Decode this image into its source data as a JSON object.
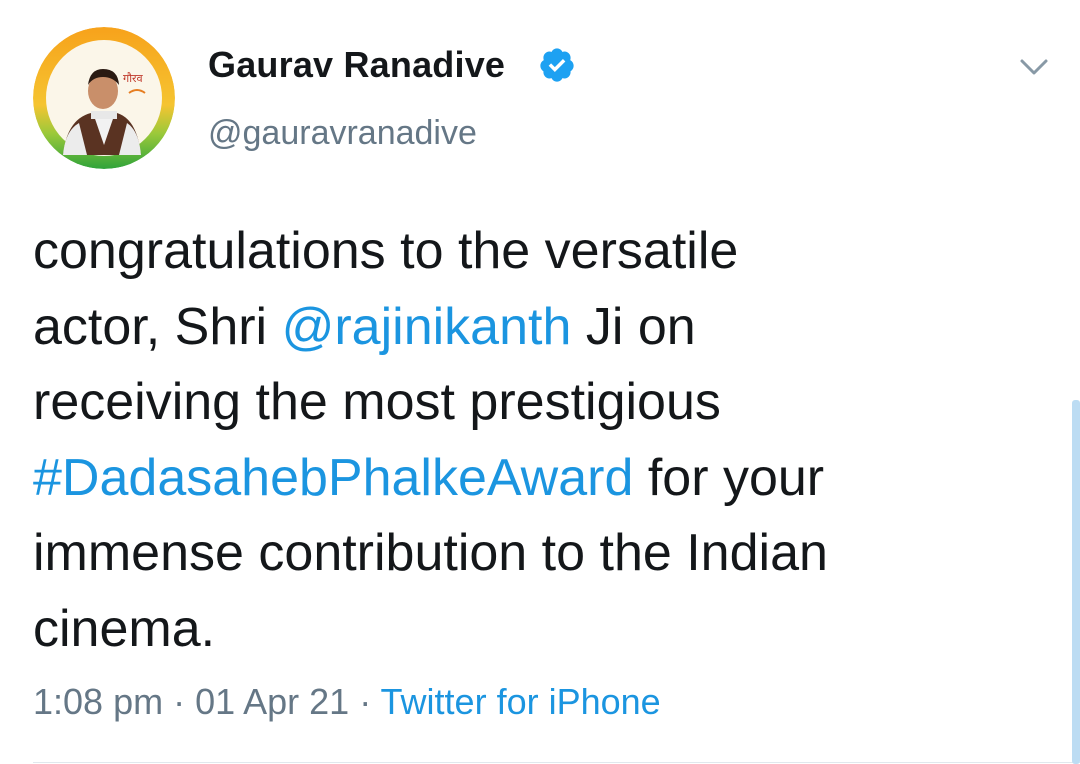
{
  "tweet": {
    "author": {
      "display_name": "Gaurav Ranadive",
      "handle": "@gauravranadive",
      "verified": true,
      "avatar_badge_text": "गौरव"
    },
    "text_lines": [
      [
        {
          "text": "congratulations to the versatile",
          "type": "text"
        }
      ],
      [
        {
          "text": "actor, Shri ",
          "type": "text"
        },
        {
          "text": "@rajinikanth",
          "type": "mention"
        },
        {
          "text": " Ji on",
          "type": "text"
        }
      ],
      [
        {
          "text": "receiving the most prestigious",
          "type": "text"
        }
      ],
      [
        {
          "text": "#DadasahebPhalkeAward",
          "type": "hashtag"
        },
        {
          "text": " for your",
          "type": "text"
        }
      ],
      [
        {
          "text": "immense contribution to the Indian",
          "type": "text"
        }
      ],
      [
        {
          "text": "cinema.",
          "type": "text"
        }
      ]
    ],
    "time": "1:08 pm",
    "separator": " · ",
    "date": "01 Apr 21",
    "source": "Twitter for iPhone"
  },
  "icons": {
    "verified": "verified-badge-icon",
    "menu": "chevron-down-icon"
  },
  "colors": {
    "link": "#1b95e0",
    "text": "#14171a",
    "secondary": "#657786",
    "verified": "#1da1f2",
    "avatar_ring_saffron": "#f39c1f",
    "avatar_ring_green": "#3aa935"
  }
}
